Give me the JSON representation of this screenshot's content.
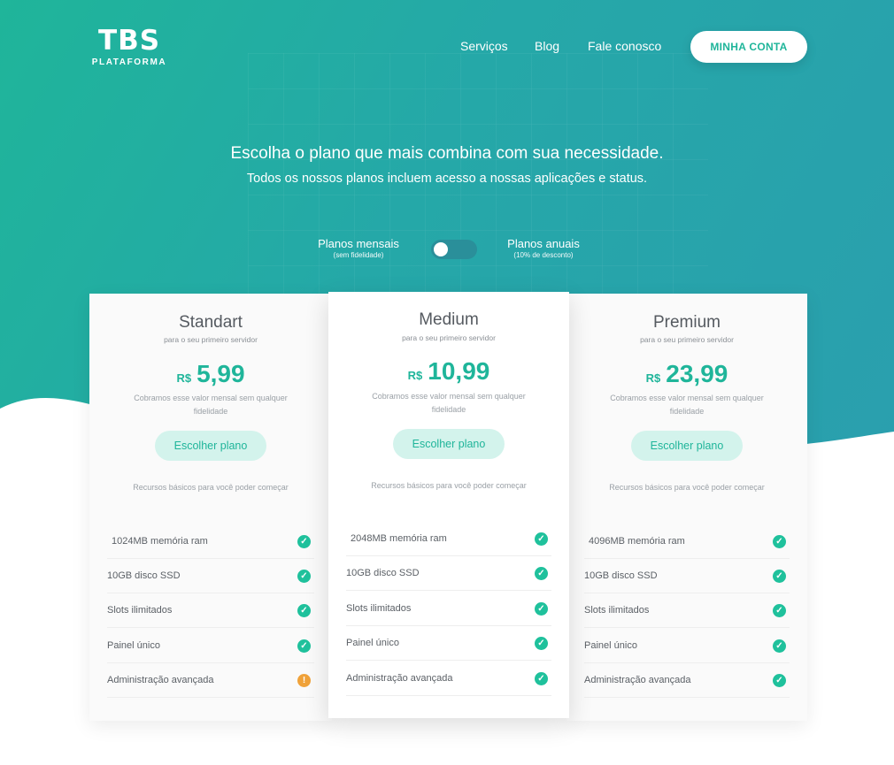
{
  "brand": {
    "title": "TBS",
    "subtitle": "PLATAFORMA"
  },
  "nav": {
    "items": [
      "Serviços",
      "Blog",
      "Fale conosco"
    ],
    "account_button": "MINHA CONTA"
  },
  "hero": {
    "headline": "Escolha o plano que mais combina com sua necessidade.",
    "subline": "Todos os nossos planos incluem acesso a nossas aplicações e status."
  },
  "billing_toggle": {
    "monthly_label": "Planos mensais",
    "monthly_note": "(sem fidelidade)",
    "annual_label": "Planos anuais",
    "annual_note": "(10% de desconto)",
    "selected": "monthly"
  },
  "plans": [
    {
      "name": "Standart",
      "tagline": "para o seu primeiro servidor",
      "currency": "R$",
      "price": "5,99",
      "note": "Cobramos esse valor mensal sem qualquer fidelidade",
      "button": "Escolher plano",
      "basic": "Recursos básicos para você poder começar",
      "features": [
        {
          "label": "1024MB memória ram",
          "status": "ok"
        },
        {
          "label": "10GB disco SSD",
          "status": "ok"
        },
        {
          "label": "Slots ilimitados",
          "status": "ok"
        },
        {
          "label": "Painel único",
          "status": "ok"
        },
        {
          "label": "Administração avançada",
          "status": "warn"
        }
      ]
    },
    {
      "name": "Medium",
      "tagline": "para o seu primeiro servidor",
      "currency": "R$",
      "price": "10,99",
      "note": "Cobramos esse valor mensal sem qualquer fidelidade",
      "button": "Escolher plano",
      "basic": "Recursos básicos para você poder começar",
      "features": [
        {
          "label": "2048MB memória ram",
          "status": "ok"
        },
        {
          "label": "10GB disco SSD",
          "status": "ok"
        },
        {
          "label": "Slots ilimitados",
          "status": "ok"
        },
        {
          "label": "Painel único",
          "status": "ok"
        },
        {
          "label": "Administração avançada",
          "status": "ok"
        }
      ]
    },
    {
      "name": "Premium",
      "tagline": "para o seu primeiro servidor",
      "currency": "R$",
      "price": "23,99",
      "note": "Cobramos esse valor mensal sem qualquer fidelidade",
      "button": "Escolher plano",
      "basic": "Recursos básicos para você poder começar",
      "features": [
        {
          "label": "4096MB memória ram",
          "status": "ok"
        },
        {
          "label": "10GB disco SSD",
          "status": "ok"
        },
        {
          "label": "Slots ilimitados",
          "status": "ok"
        },
        {
          "label": "Painel único",
          "status": "ok"
        },
        {
          "label": "Administração avançada",
          "status": "ok"
        }
      ]
    }
  ],
  "icons": {
    "ok": "check-circle-icon",
    "warn": "exclamation-circle-icon"
  },
  "colors": {
    "accent": "#1fb59a",
    "ok": "#1fc19c",
    "warn": "#f0a23a",
    "button_bg": "#d3f3ec"
  }
}
